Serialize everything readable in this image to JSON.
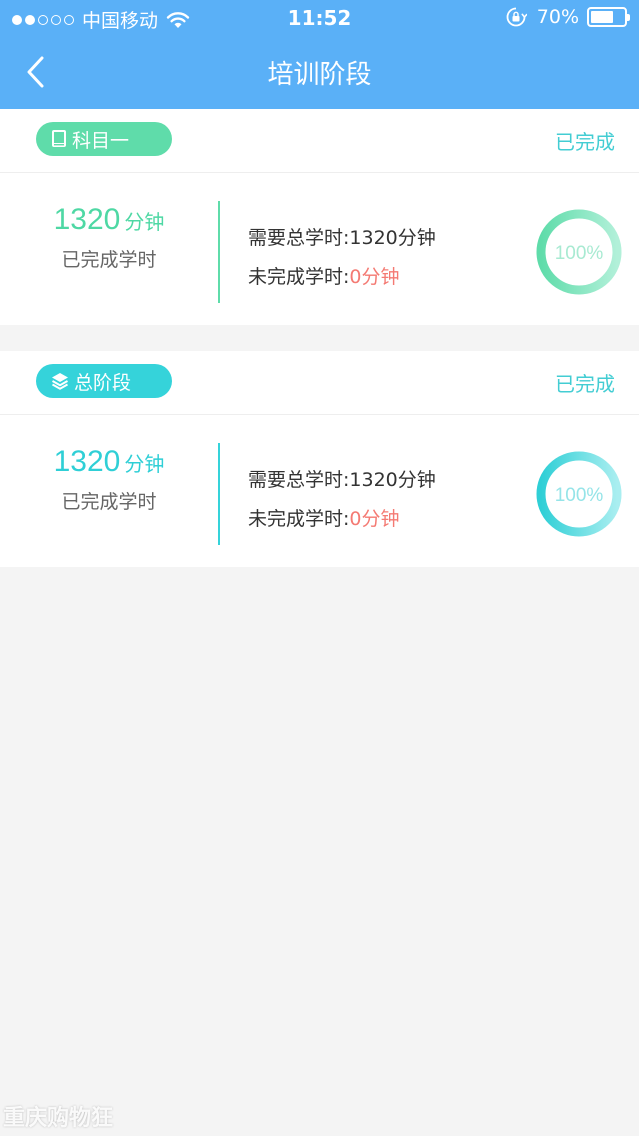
{
  "status_bar": {
    "carrier": "中国移动",
    "time": "11:52",
    "battery_percent_text": "70%",
    "battery_level": 0.7
  },
  "nav": {
    "title": "培训阶段"
  },
  "cards": [
    {
      "tag": "科目一",
      "status": "已完成",
      "done_value": "1320",
      "done_unit": "分钟",
      "done_label": "已完成学时",
      "required_label": "需要总学时:",
      "required_value": "1320分钟",
      "remaining_label": "未完成学时:",
      "remaining_value": "0分钟",
      "progress_text": "100%",
      "progress": 1.0
    },
    {
      "tag": "总阶段",
      "status": "已完成",
      "done_value": "1320",
      "done_unit": "分钟",
      "done_label": "已完成学时",
      "required_label": "需要总学时:",
      "required_value": "1320分钟",
      "remaining_label": "未完成学时:",
      "remaining_value": "0分钟",
      "progress_text": "100%",
      "progress": 1.0
    }
  ],
  "watermark": "重庆购物狂",
  "colors": {
    "header": "#5ab0f7",
    "green": "#5fdcaa",
    "cyan": "#35d3da",
    "remaining": "#f47a73"
  }
}
